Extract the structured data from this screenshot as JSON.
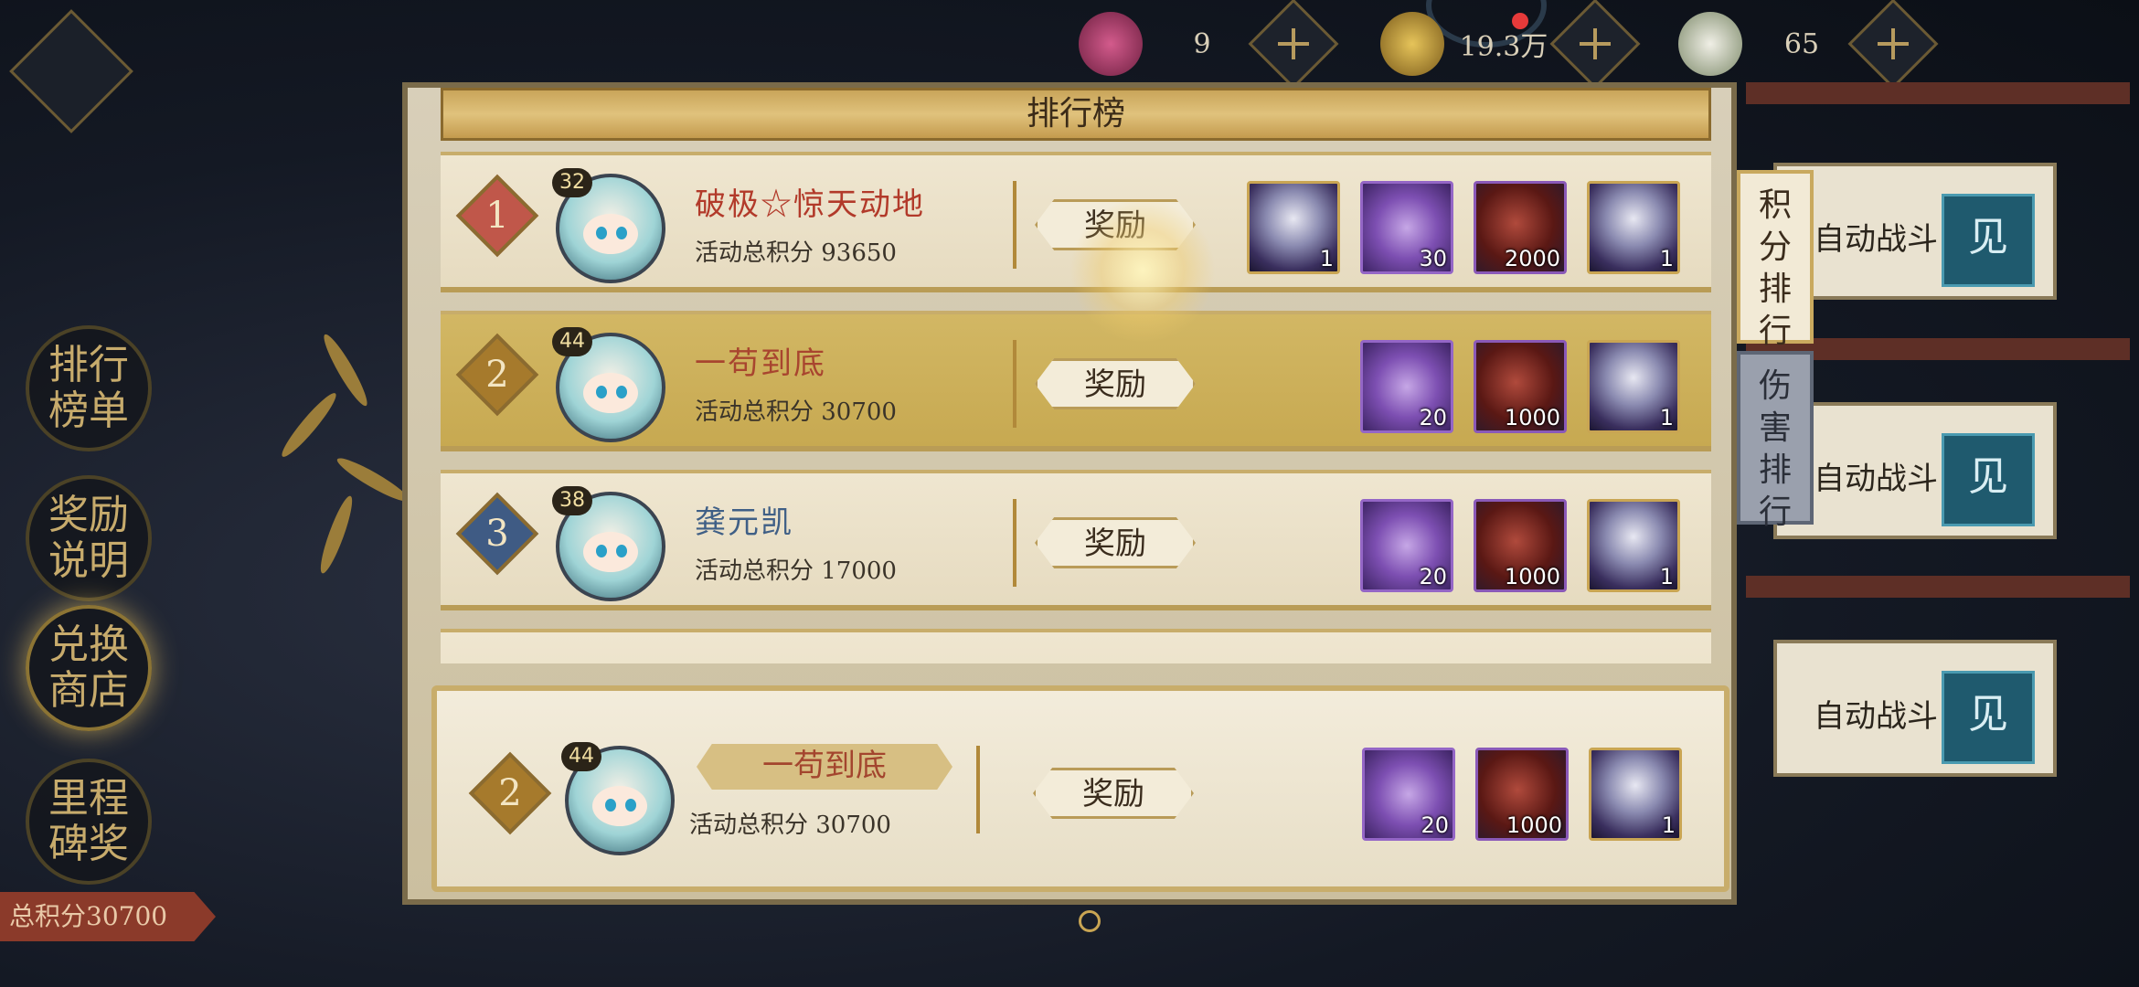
{
  "currencies": [
    {
      "icon": "pouch-icon",
      "value": "9"
    },
    {
      "icon": "gold-ingot-icon",
      "value": "19.3万"
    },
    {
      "icon": "steamed-bun-icon",
      "value": "65"
    }
  ],
  "left_menu": [
    {
      "label": "排行\n榜单",
      "name": "menu-ranking-list"
    },
    {
      "label": "奖励\n说明",
      "name": "menu-reward-info"
    },
    {
      "label": "兑换\n商店",
      "name": "menu-exchange-shop"
    },
    {
      "label": "里程\n碑奖",
      "name": "menu-milestone-reward"
    }
  ],
  "total_score_label": "总积分30700",
  "panel": {
    "title": "排行榜",
    "reward_label": "奖励",
    "tabs": [
      {
        "label": "积分排行",
        "active": true
      },
      {
        "label": "伤害排行",
        "active": false
      }
    ]
  },
  "rows": [
    {
      "rank": "1",
      "level": "32",
      "name": "破极☆惊天动地",
      "score": "活动总积分 93650",
      "name_color": "#b23a2a",
      "rank_color": "#c0574a",
      "items": [
        {
          "type": "hero",
          "count": "1"
        },
        {
          "type": "potion",
          "count": "30"
        },
        {
          "type": "orb",
          "count": "2000"
        },
        {
          "type": "hero",
          "count": "1"
        }
      ]
    },
    {
      "rank": "2",
      "level": "44",
      "name": "一苟到底",
      "score": "活动总积分 30700",
      "name_color": "#a8452f",
      "rank_color": "#a67a2c",
      "items": [
        {
          "type": "potion",
          "count": "20"
        },
        {
          "type": "orb",
          "count": "1000"
        },
        {
          "type": "hero",
          "count": "1"
        }
      ]
    },
    {
      "rank": "3",
      "level": "38",
      "name": "龚元凯",
      "score": "活动总积分 17000",
      "name_color": "#3f5f86",
      "rank_color": "#3f5b84",
      "items": [
        {
          "type": "potion",
          "count": "20"
        },
        {
          "type": "orb",
          "count": "1000"
        },
        {
          "type": "hero",
          "count": "1"
        }
      ]
    }
  ],
  "self_row": {
    "rank": "2",
    "level": "44",
    "name": "一苟到底",
    "score": "活动总积分 30700",
    "items": [
      {
        "type": "potion",
        "count": "20"
      },
      {
        "type": "orb",
        "count": "1000"
      },
      {
        "type": "hero",
        "count": "1"
      }
    ]
  },
  "side_panels": [
    {
      "label": "自动战斗",
      "see": "见"
    },
    {
      "label": "自动战斗",
      "see": "见"
    },
    {
      "label": "自动战斗",
      "see": "见"
    }
  ]
}
